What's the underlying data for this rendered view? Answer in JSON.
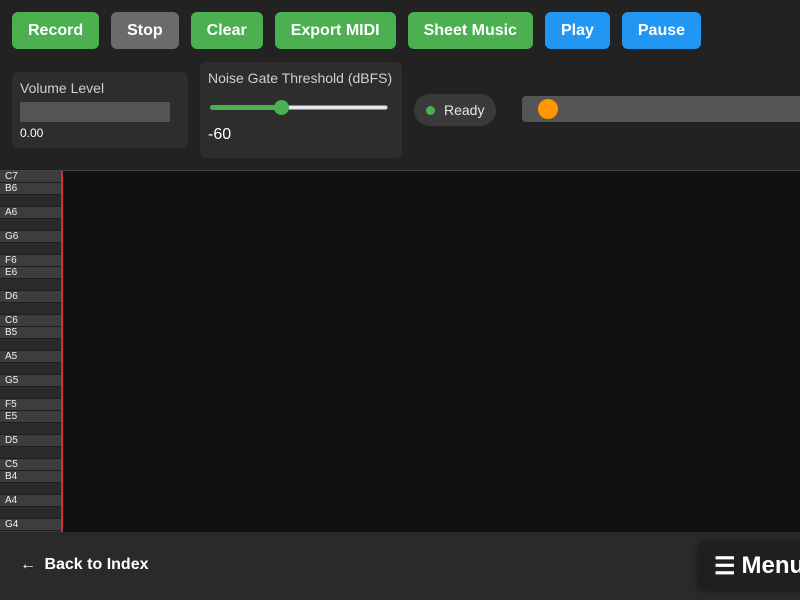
{
  "toolbar": {
    "buttons": [
      {
        "label": "Record",
        "color": "#4caf50"
      },
      {
        "label": "Stop",
        "color": "#6b6b6b"
      },
      {
        "label": "Clear",
        "color": "#4caf50"
      },
      {
        "label": "Export MIDI",
        "color": "#4caf50"
      },
      {
        "label": "Sheet Music",
        "color": "#4caf50"
      },
      {
        "label": "Play",
        "color": "#2196f3"
      },
      {
        "label": "Pause",
        "color": "#2196f3"
      }
    ]
  },
  "volume": {
    "label": "Volume Level",
    "value_text": "0.00",
    "level": 0
  },
  "noise_gate": {
    "label": "Noise Gate Threshold (dBFS)",
    "value_text": "-60",
    "min": -100,
    "max": 0,
    "value": -60
  },
  "status": {
    "text": "Ready",
    "dot_color": "#4caf50"
  },
  "seek": {
    "thumb_color": "#ff9800",
    "position_fraction": 0.0
  },
  "piano_roll": {
    "keys": [
      {
        "label": "C7",
        "black": false
      },
      {
        "label": "B6",
        "black": false
      },
      {
        "label": "",
        "black": true
      },
      {
        "label": "A6",
        "black": false
      },
      {
        "label": "",
        "black": true
      },
      {
        "label": "G6",
        "black": false
      },
      {
        "label": "",
        "black": true
      },
      {
        "label": "F6",
        "black": false
      },
      {
        "label": "E6",
        "black": false
      },
      {
        "label": "",
        "black": true
      },
      {
        "label": "D6",
        "black": false
      },
      {
        "label": "",
        "black": true
      },
      {
        "label": "C6",
        "black": false
      },
      {
        "label": "B5",
        "black": false
      },
      {
        "label": "",
        "black": true
      },
      {
        "label": "A5",
        "black": false
      },
      {
        "label": "",
        "black": true
      },
      {
        "label": "G5",
        "black": false
      },
      {
        "label": "",
        "black": true
      },
      {
        "label": "F5",
        "black": false
      },
      {
        "label": "E5",
        "black": false
      },
      {
        "label": "",
        "black": true
      },
      {
        "label": "D5",
        "black": false
      },
      {
        "label": "",
        "black": true
      },
      {
        "label": "C5",
        "black": false
      },
      {
        "label": "B4",
        "black": false
      },
      {
        "label": "",
        "black": true
      },
      {
        "label": "A4",
        "black": false
      },
      {
        "label": "",
        "black": true
      },
      {
        "label": "G4",
        "black": false
      }
    ],
    "playhead_color": "#d32f2f"
  },
  "footer": {
    "back_arrow": "←",
    "back_label": "Back to Index",
    "menu_icon": "☰",
    "menu_label": "Menu"
  }
}
